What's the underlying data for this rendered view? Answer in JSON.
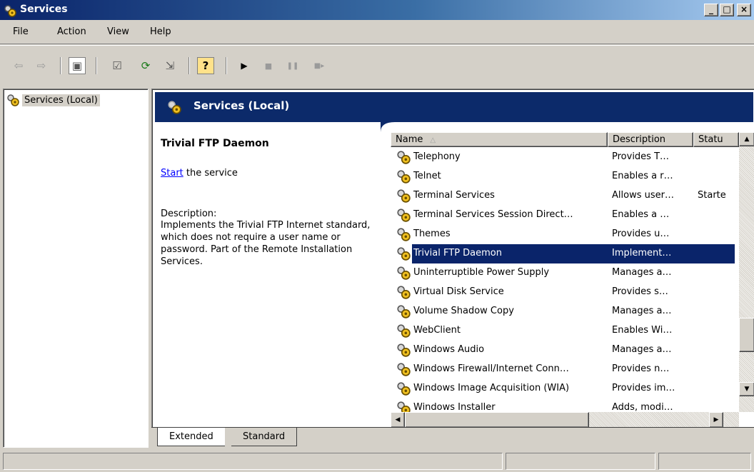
{
  "window": {
    "title": "Services",
    "minimize_glyph": "_",
    "maximize_glyph": "□",
    "close_glyph": "×"
  },
  "menu": {
    "file": "File",
    "action": "Action",
    "view": "View",
    "help": "Help"
  },
  "toolbar": {
    "back_glyph": "⇦",
    "forward_glyph": "⇨",
    "show_tree_glyph": "▣",
    "properties_glyph": "☑",
    "refresh_glyph": "⟳",
    "export_glyph": "⇲",
    "help_glyph": "?",
    "start_glyph": "▶",
    "stop_glyph": "■",
    "pause_glyph": "❚❚",
    "restart_glyph": "■▸"
  },
  "tree": {
    "root_label": "Services (Local)"
  },
  "pane": {
    "header_title": "Services (Local)",
    "selected_service": "Trivial FTP Daemon",
    "start_link": "Start",
    "start_suffix": " the service",
    "description_label": "Description:",
    "description_text": "Implements the Trivial FTP Internet standard, which does not require a user name or password. Part of the Remote Installation Services."
  },
  "list": {
    "columns": [
      "Name",
      "Description",
      "Statu"
    ],
    "sort_indicator": "△",
    "rows": [
      {
        "name": "Telephony",
        "description": "Provides T…",
        "status": ""
      },
      {
        "name": "Telnet",
        "description": "Enables a r…",
        "status": ""
      },
      {
        "name": "Terminal Services",
        "description": "Allows user…",
        "status": "Starte"
      },
      {
        "name": "Terminal Services Session Direct…",
        "description": "Enables a …",
        "status": ""
      },
      {
        "name": "Themes",
        "description": "Provides u…",
        "status": ""
      },
      {
        "name": "Trivial FTP Daemon",
        "description": "Implement…",
        "status": ""
      },
      {
        "name": "Uninterruptible Power Supply",
        "description": "Manages a…",
        "status": ""
      },
      {
        "name": "Virtual Disk Service",
        "description": "Provides s…",
        "status": ""
      },
      {
        "name": "Volume Shadow Copy",
        "description": "Manages a…",
        "status": ""
      },
      {
        "name": "WebClient",
        "description": "Enables Wi…",
        "status": ""
      },
      {
        "name": "Windows Audio",
        "description": "Manages a…",
        "status": ""
      },
      {
        "name": "Windows Firewall/Internet Conn…",
        "description": "Provides n…",
        "status": ""
      },
      {
        "name": "Windows Image Acquisition (WIA)",
        "description": "Provides im…",
        "status": ""
      },
      {
        "name": "Windows Installer",
        "description": "Adds, modi…",
        "status": ""
      }
    ],
    "selected_index": 5,
    "vscroll_position": 0.85
  },
  "tabs": {
    "extended": "Extended",
    "standard": "Standard"
  },
  "colors": {
    "selection": "#0a246a",
    "header_band": "#0c2a6a",
    "link": "#0000ff"
  }
}
